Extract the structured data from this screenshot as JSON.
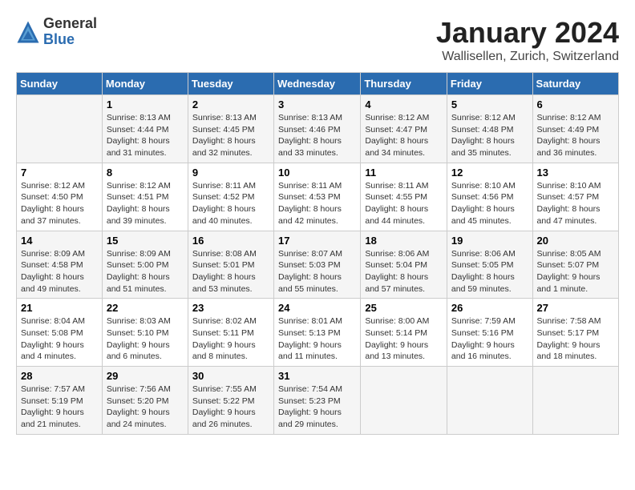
{
  "logo": {
    "general": "General",
    "blue": "Blue"
  },
  "title": "January 2024",
  "location": "Wallisellen, Zurich, Switzerland",
  "days_of_week": [
    "Sunday",
    "Monday",
    "Tuesday",
    "Wednesday",
    "Thursday",
    "Friday",
    "Saturday"
  ],
  "weeks": [
    [
      {
        "day": "",
        "sunrise": "",
        "sunset": "",
        "daylight": ""
      },
      {
        "day": "1",
        "sunrise": "Sunrise: 8:13 AM",
        "sunset": "Sunset: 4:44 PM",
        "daylight": "Daylight: 8 hours and 31 minutes."
      },
      {
        "day": "2",
        "sunrise": "Sunrise: 8:13 AM",
        "sunset": "Sunset: 4:45 PM",
        "daylight": "Daylight: 8 hours and 32 minutes."
      },
      {
        "day": "3",
        "sunrise": "Sunrise: 8:13 AM",
        "sunset": "Sunset: 4:46 PM",
        "daylight": "Daylight: 8 hours and 33 minutes."
      },
      {
        "day": "4",
        "sunrise": "Sunrise: 8:12 AM",
        "sunset": "Sunset: 4:47 PM",
        "daylight": "Daylight: 8 hours and 34 minutes."
      },
      {
        "day": "5",
        "sunrise": "Sunrise: 8:12 AM",
        "sunset": "Sunset: 4:48 PM",
        "daylight": "Daylight: 8 hours and 35 minutes."
      },
      {
        "day": "6",
        "sunrise": "Sunrise: 8:12 AM",
        "sunset": "Sunset: 4:49 PM",
        "daylight": "Daylight: 8 hours and 36 minutes."
      }
    ],
    [
      {
        "day": "7",
        "sunrise": "Sunrise: 8:12 AM",
        "sunset": "Sunset: 4:50 PM",
        "daylight": "Daylight: 8 hours and 37 minutes."
      },
      {
        "day": "8",
        "sunrise": "Sunrise: 8:12 AM",
        "sunset": "Sunset: 4:51 PM",
        "daylight": "Daylight: 8 hours and 39 minutes."
      },
      {
        "day": "9",
        "sunrise": "Sunrise: 8:11 AM",
        "sunset": "Sunset: 4:52 PM",
        "daylight": "Daylight: 8 hours and 40 minutes."
      },
      {
        "day": "10",
        "sunrise": "Sunrise: 8:11 AM",
        "sunset": "Sunset: 4:53 PM",
        "daylight": "Daylight: 8 hours and 42 minutes."
      },
      {
        "day": "11",
        "sunrise": "Sunrise: 8:11 AM",
        "sunset": "Sunset: 4:55 PM",
        "daylight": "Daylight: 8 hours and 44 minutes."
      },
      {
        "day": "12",
        "sunrise": "Sunrise: 8:10 AM",
        "sunset": "Sunset: 4:56 PM",
        "daylight": "Daylight: 8 hours and 45 minutes."
      },
      {
        "day": "13",
        "sunrise": "Sunrise: 8:10 AM",
        "sunset": "Sunset: 4:57 PM",
        "daylight": "Daylight: 8 hours and 47 minutes."
      }
    ],
    [
      {
        "day": "14",
        "sunrise": "Sunrise: 8:09 AM",
        "sunset": "Sunset: 4:58 PM",
        "daylight": "Daylight: 8 hours and 49 minutes."
      },
      {
        "day": "15",
        "sunrise": "Sunrise: 8:09 AM",
        "sunset": "Sunset: 5:00 PM",
        "daylight": "Daylight: 8 hours and 51 minutes."
      },
      {
        "day": "16",
        "sunrise": "Sunrise: 8:08 AM",
        "sunset": "Sunset: 5:01 PM",
        "daylight": "Daylight: 8 hours and 53 minutes."
      },
      {
        "day": "17",
        "sunrise": "Sunrise: 8:07 AM",
        "sunset": "Sunset: 5:03 PM",
        "daylight": "Daylight: 8 hours and 55 minutes."
      },
      {
        "day": "18",
        "sunrise": "Sunrise: 8:06 AM",
        "sunset": "Sunset: 5:04 PM",
        "daylight": "Daylight: 8 hours and 57 minutes."
      },
      {
        "day": "19",
        "sunrise": "Sunrise: 8:06 AM",
        "sunset": "Sunset: 5:05 PM",
        "daylight": "Daylight: 8 hours and 59 minutes."
      },
      {
        "day": "20",
        "sunrise": "Sunrise: 8:05 AM",
        "sunset": "Sunset: 5:07 PM",
        "daylight": "Daylight: 9 hours and 1 minute."
      }
    ],
    [
      {
        "day": "21",
        "sunrise": "Sunrise: 8:04 AM",
        "sunset": "Sunset: 5:08 PM",
        "daylight": "Daylight: 9 hours and 4 minutes."
      },
      {
        "day": "22",
        "sunrise": "Sunrise: 8:03 AM",
        "sunset": "Sunset: 5:10 PM",
        "daylight": "Daylight: 9 hours and 6 minutes."
      },
      {
        "day": "23",
        "sunrise": "Sunrise: 8:02 AM",
        "sunset": "Sunset: 5:11 PM",
        "daylight": "Daylight: 9 hours and 8 minutes."
      },
      {
        "day": "24",
        "sunrise": "Sunrise: 8:01 AM",
        "sunset": "Sunset: 5:13 PM",
        "daylight": "Daylight: 9 hours and 11 minutes."
      },
      {
        "day": "25",
        "sunrise": "Sunrise: 8:00 AM",
        "sunset": "Sunset: 5:14 PM",
        "daylight": "Daylight: 9 hours and 13 minutes."
      },
      {
        "day": "26",
        "sunrise": "Sunrise: 7:59 AM",
        "sunset": "Sunset: 5:16 PM",
        "daylight": "Daylight: 9 hours and 16 minutes."
      },
      {
        "day": "27",
        "sunrise": "Sunrise: 7:58 AM",
        "sunset": "Sunset: 5:17 PM",
        "daylight": "Daylight: 9 hours and 18 minutes."
      }
    ],
    [
      {
        "day": "28",
        "sunrise": "Sunrise: 7:57 AM",
        "sunset": "Sunset: 5:19 PM",
        "daylight": "Daylight: 9 hours and 21 minutes."
      },
      {
        "day": "29",
        "sunrise": "Sunrise: 7:56 AM",
        "sunset": "Sunset: 5:20 PM",
        "daylight": "Daylight: 9 hours and 24 minutes."
      },
      {
        "day": "30",
        "sunrise": "Sunrise: 7:55 AM",
        "sunset": "Sunset: 5:22 PM",
        "daylight": "Daylight: 9 hours and 26 minutes."
      },
      {
        "day": "31",
        "sunrise": "Sunrise: 7:54 AM",
        "sunset": "Sunset: 5:23 PM",
        "daylight": "Daylight: 9 hours and 29 minutes."
      },
      {
        "day": "",
        "sunrise": "",
        "sunset": "",
        "daylight": ""
      },
      {
        "day": "",
        "sunrise": "",
        "sunset": "",
        "daylight": ""
      },
      {
        "day": "",
        "sunrise": "",
        "sunset": "",
        "daylight": ""
      }
    ]
  ]
}
